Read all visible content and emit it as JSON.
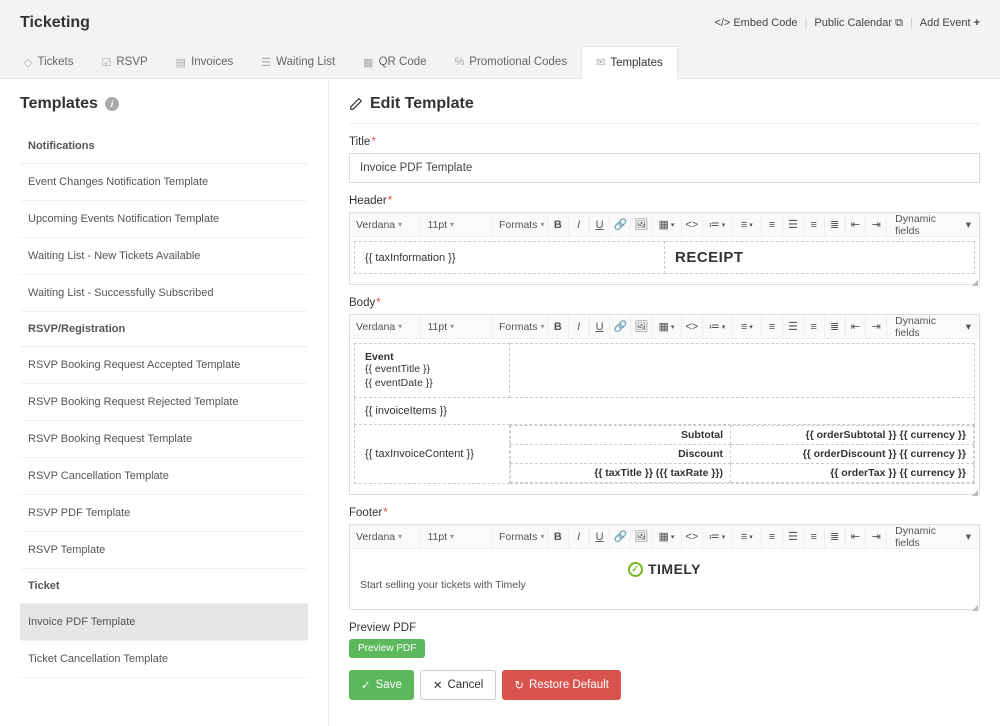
{
  "header": {
    "title": "Ticketing",
    "actions": {
      "embed": "Embed Code",
      "calendar": "Public Calendar",
      "add": "Add Event"
    }
  },
  "tabs": [
    {
      "label": "Tickets"
    },
    {
      "label": "RSVP"
    },
    {
      "label": "Invoices"
    },
    {
      "label": "Waiting List"
    },
    {
      "label": "QR Code"
    },
    {
      "label": "Promotional Codes"
    },
    {
      "label": "Templates"
    }
  ],
  "sidebar": {
    "title": "Templates",
    "groups": {
      "notifications": "Notifications",
      "rsvp": "RSVP/Registration",
      "ticket": "Ticket"
    },
    "items": {
      "n1": "Event Changes Notification Template",
      "n2": "Upcoming Events Notification Template",
      "n3": "Waiting List - New Tickets Available",
      "n4": "Waiting List - Successfully Subscribed",
      "r1": "RSVP Booking Request Accepted Template",
      "r2": "RSVP Booking Request Rejected Template",
      "r3": "RSVP Booking Request Template",
      "r4": "RSVP Cancellation Template",
      "r5": "RSVP PDF Template",
      "r6": "RSVP Template",
      "t1": "Invoice PDF Template",
      "t2": "Ticket Cancellation Template"
    }
  },
  "edit": {
    "page_title": "Edit Template",
    "labels": {
      "title": "Title",
      "header": "Header",
      "body": "Body",
      "footer": "Footer",
      "preview": "Preview PDF"
    },
    "title_value": "Invoice PDF Template",
    "toolbar": {
      "font": "Verdana",
      "size": "11pt",
      "formats": "Formats",
      "dynamic": "Dynamic fields"
    },
    "header_content": {
      "left": "{{ taxInformation }}",
      "right": "RECEIPT"
    },
    "body_content": {
      "event_heading": "Event",
      "event_title": "{{ eventTitle }}",
      "event_date": "{{ eventDate }}",
      "invoice_items": "{{ invoiceItems }}",
      "tax_invoice": "{{ taxInvoiceContent }}",
      "sub_label": "Subtotal",
      "disc_label": "Discount",
      "tax_label": "{{ taxTitle }} ({{ taxRate }})",
      "sub_val": "{{ orderSubtotal }} {{ currency }}",
      "disc_val": "{{ orderDiscount }} {{ currency }}",
      "tax_val": "{{ orderTax }} {{ currency }}"
    },
    "footer_content": {
      "brand": "TIMELY",
      "tagline": "Start selling your tickets with Timely"
    },
    "buttons": {
      "preview": "Preview PDF",
      "save": "Save",
      "cancel": "Cancel",
      "restore": "Restore Default"
    }
  }
}
